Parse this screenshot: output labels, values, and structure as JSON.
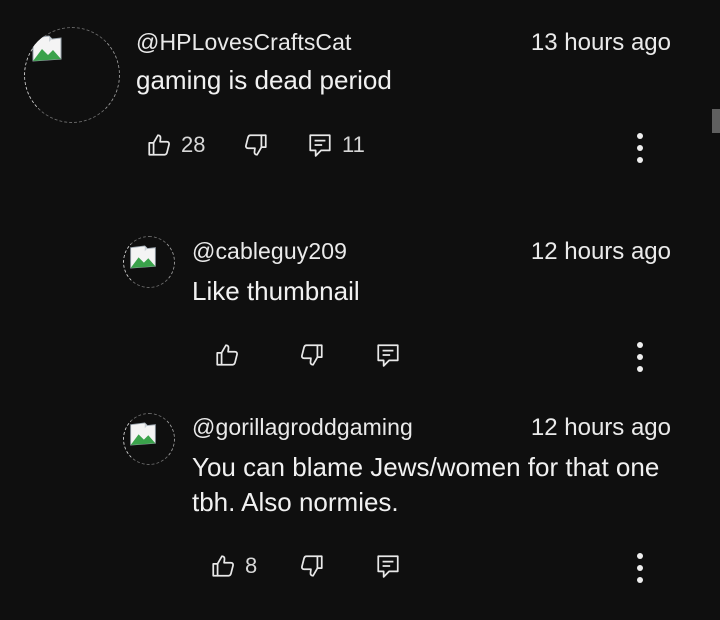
{
  "comments": [
    {
      "handle": "@HPLovesCraftsCat",
      "time": "13 hours ago",
      "text": "gaming is dead period",
      "likes": "28",
      "replies": "11"
    },
    {
      "handle": "@cableguy209",
      "time": "12 hours ago",
      "text": "Like thumbnail",
      "likes": "",
      "replies": ""
    },
    {
      "handle": "@gorillagroddgaming",
      "time": "12 hours ago",
      "text": "You can blame Jews/women for that one tbh. Also normies.",
      "likes": "8",
      "replies": ""
    }
  ],
  "icons": {
    "like": "thumbs-up-icon",
    "dislike": "thumbs-down-icon",
    "reply": "reply-icon",
    "menu": "more-vertical-icon",
    "avatar": "broken-image-icon"
  },
  "colors": {
    "background": "#0f0f0f",
    "text": "#f1f1f1",
    "secondary": "#d7d7d7"
  }
}
